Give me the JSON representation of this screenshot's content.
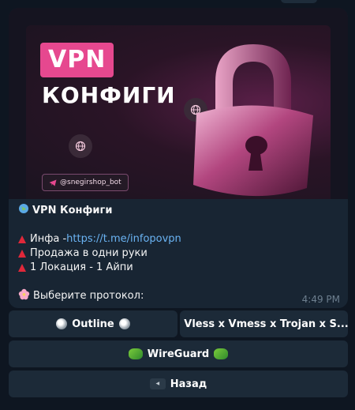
{
  "banner": {
    "vpn_label": "VPN",
    "title": "КОНФИГИ",
    "handle": "@snegirshop_bot",
    "colors": {
      "accent": "#e6488f",
      "background": "#1b1420"
    }
  },
  "message": {
    "header": "VPN Конфиги",
    "info_prefix": "Инфа - ",
    "info_link": "https://t.me/infopovpn",
    "line_sale": "Продажа в одни руки",
    "line_location": "1 Локация - 1 Айпи",
    "prompt": "Выберите протокол:",
    "time": "4:49 PM"
  },
  "keyboard": {
    "outline": "Outline",
    "vless": "Vless x Vmess x Trojan x S...",
    "wireguard": "WireGuard",
    "back": "Назад"
  }
}
